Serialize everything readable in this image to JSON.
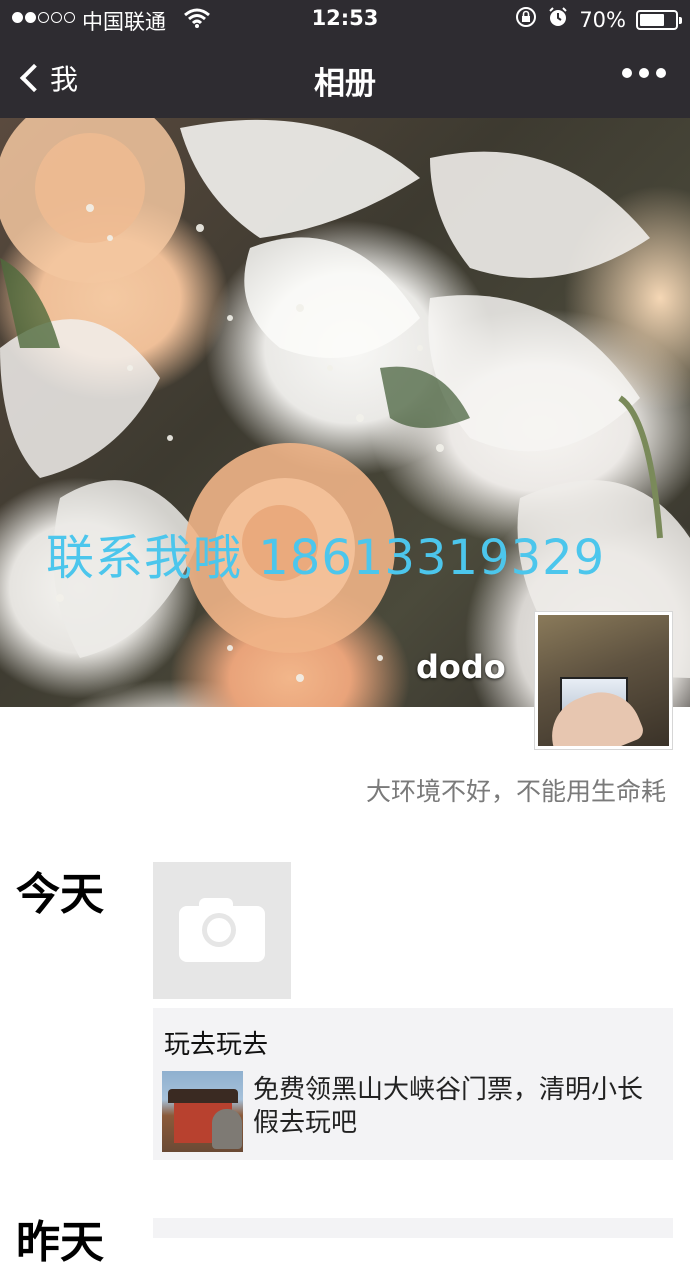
{
  "status_bar": {
    "carrier": "中国联通",
    "time": "12:53",
    "battery_percent": "70%",
    "battery_level": 0.7,
    "signal_bars": 2
  },
  "nav": {
    "back_label": "我",
    "title": "相册"
  },
  "cover": {
    "overlay_text": "联系我哦 18613319329",
    "username": "dodo",
    "accent_color": "#4cc6ec"
  },
  "profile": {
    "signature": "大环境不好，不能用生命耗"
  },
  "timeline": {
    "today_label": "今天",
    "yesterday_label": "昨天",
    "post": {
      "title": "玩去玩去",
      "description": "免费领黑山大峡谷门票，清明小长假去玩吧"
    }
  },
  "icons": {
    "back": "chevron-left-icon",
    "more": "more-dots-icon",
    "camera": "camera-icon",
    "wifi": "wifi-icon",
    "rotation_lock": "rotation-lock-icon",
    "alarm": "alarm-icon",
    "battery": "battery-icon"
  }
}
